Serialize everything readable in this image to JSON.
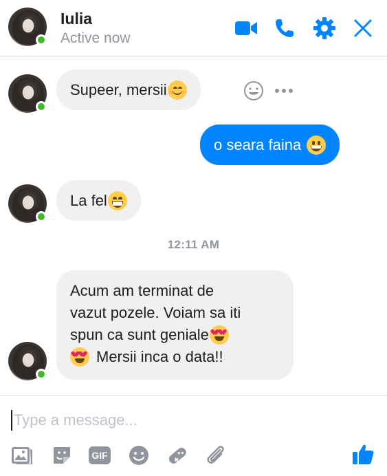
{
  "header": {
    "name": "Iulia",
    "status": "Active now",
    "icons": [
      "video-camera-icon",
      "phone-icon",
      "gear-icon",
      "close-icon"
    ],
    "accent": "#0084ff"
  },
  "messages": [
    {
      "from": "contact",
      "text": "Supeer, mersii",
      "emoji": "smiling-blush"
    },
    {
      "from": "me",
      "text": "o seara faina",
      "emoji": "grinning"
    },
    {
      "from": "contact",
      "text": "La fel",
      "emoji": "beaming-grin"
    },
    {
      "timestamp": "12:11 AM"
    },
    {
      "from": "contact",
      "lines": [
        "Acum am terminat de",
        "vazut pozele. Voiam sa iti",
        "spun ca sunt geniale",
        "Mersii inca o data!!"
      ],
      "emoji": "heart-eyes"
    }
  ],
  "composer": {
    "placeholder": "Type a message...",
    "tools": [
      "photo-icon",
      "sticker-icon",
      "gif-icon",
      "emoji-icon",
      "game-icon",
      "attachment-icon",
      "like-icon"
    ],
    "gif_label": "GIF"
  },
  "colors": {
    "incoming_bubble": "#f1f0f0",
    "outgoing_bubble": "#0084ff",
    "online": "#42b72a",
    "muted": "#90949c"
  }
}
